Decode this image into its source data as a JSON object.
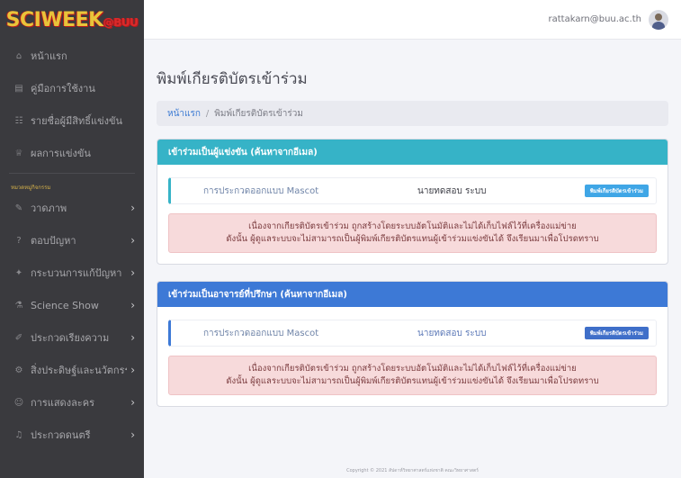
{
  "logo": {
    "text": "SCIWEEK",
    "suffix": "@BUU"
  },
  "sidebar": {
    "items": [
      {
        "label": "หน้าแรก",
        "icon": "home-icon",
        "glyph": "⌂",
        "chevron": false
      },
      {
        "label": "คู่มือการใช้งาน",
        "icon": "book-icon",
        "glyph": "▤",
        "chevron": false
      },
      {
        "label": "รายชื่อผู้มีสิทธิ์แข่งขัน",
        "icon": "users-icon",
        "glyph": "☷",
        "chevron": false
      },
      {
        "label": "ผลการแข่งขัน",
        "icon": "trophy-icon",
        "glyph": "♕",
        "chevron": false
      }
    ],
    "heading": "หมวดหมู่กิจกรรม",
    "groups": [
      {
        "label": "วาดภาพ",
        "icon": "brush-icon",
        "glyph": "✎",
        "chevron": true
      },
      {
        "label": "ตอบปัญหา",
        "icon": "question-icon",
        "glyph": "?",
        "chevron": true
      },
      {
        "label": "กระบวนการแก้ปัญหา",
        "icon": "bulb-icon",
        "glyph": "✦",
        "chevron": true
      },
      {
        "label": "Science Show",
        "icon": "flask-icon",
        "glyph": "⚗",
        "chevron": true
      },
      {
        "label": "ประกวดเรียงความ",
        "icon": "pen-icon",
        "glyph": "✐",
        "chevron": true
      },
      {
        "label": "สิ่งประดิษฐ์และนวัตกรรม",
        "icon": "gear-icon",
        "glyph": "⚙",
        "chevron": true
      },
      {
        "label": "การแสดงละคร",
        "icon": "mask-icon",
        "glyph": "☺",
        "chevron": true
      },
      {
        "label": "ประกวดดนตรี",
        "icon": "music-icon",
        "glyph": "♫",
        "chevron": true
      }
    ],
    "chevron_glyph": "›"
  },
  "topbar": {
    "email": "rattakarn@buu.ac.th"
  },
  "page": {
    "title": "พิมพ์เกียรติบัตรเข้าร่วม",
    "breadcrumb": {
      "home": "หน้าแรก",
      "separator": "/",
      "current": "พิมพ์เกียรติบัตรเข้าร่วม"
    }
  },
  "competitor_card": {
    "header": "เข้าร่วมเป็นผู้แข่งขัน (ค้นหาจากอีเมล)",
    "entry": {
      "title": "การประกวดออกแบบ Mascot",
      "name": "นายทดสอบ ระบบ",
      "button": "พิมพ์เกียรติบัตรเข้าร่วม"
    },
    "alert_line1": "เนื่องจากเกียรติบัตรเข้าร่วม ถูกสร้างโดยระบบอัตโนมัติและไม่ได้เก็บไฟล์ไว้ที่เครื่องแม่ข่าย",
    "alert_line2": "ดังนั้น ผู้ดูแลระบบจะไม่สามารถเป็นผู้พิมพ์เกียรติบัตรแทนผู้เข้าร่วมแข่งขันได้ จึงเรียนมาเพื่อโปรดทราบ"
  },
  "advisor_card": {
    "header": "เข้าร่วมเป็นอาจารย์ที่ปรึกษา (ค้นหาจากอีเมล)",
    "entry": {
      "title": "การประกวดออกแบบ Mascot",
      "name": "นายทดสอบ ระบบ",
      "button": "พิมพ์เกียรติบัตรเข้าร่วม"
    },
    "alert_line1": "เนื่องจากเกียรติบัตรเข้าร่วม ถูกสร้างโดยระบบอัตโนมัติและไม่ได้เก็บไฟล์ไว้ที่เครื่องแม่ข่าย",
    "alert_line2": "ดังนั้น ผู้ดูแลระบบจะไม่สามารถเป็นผู้พิมพ์เกียรติบัตรแทนผู้เข้าร่วมแข่งขันได้ จึงเรียนมาเพื่อโปรดทราบ"
  },
  "footer": {
    "text": "Copyright © 2021 สัปดาห์วิทยาศาสตร์แห่งชาติ คณะวิทยาศาสตร์"
  }
}
